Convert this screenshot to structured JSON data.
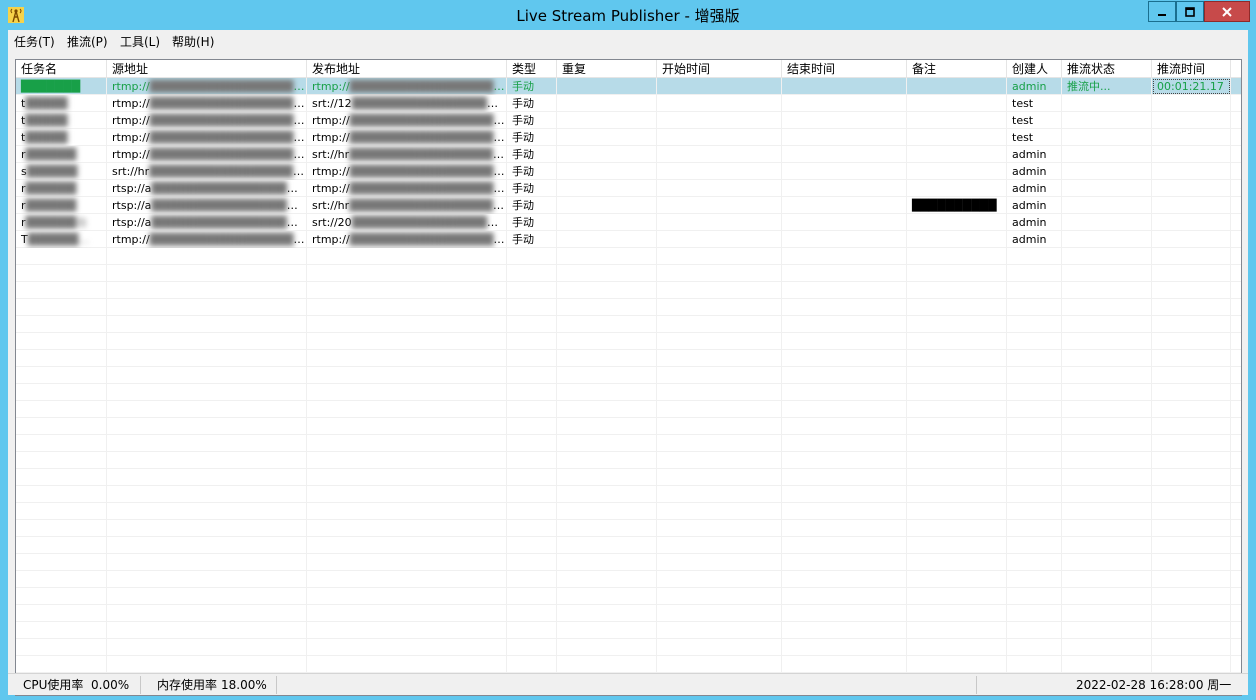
{
  "window": {
    "title": "Live Stream Publisher - 增强版",
    "app_icon": "broadcast-tower-icon"
  },
  "menu": [
    {
      "label": "任务(T)"
    },
    {
      "label": "推流(P)"
    },
    {
      "label": "工具(L)"
    },
    {
      "label": "帮助(H)"
    }
  ],
  "table": {
    "columns": [
      "任务名",
      "源地址",
      "发布地址",
      "类型",
      "重复",
      "开始时间",
      "结束时间",
      "备注",
      "创建人",
      "推流状态",
      "推流时间"
    ],
    "rows": [
      {
        "name": "███████",
        "source": "rtmp://███████████████████████",
        "target": "rtmp://████████████████████████",
        "type": "手动",
        "repeat": "",
        "start": "",
        "end": "",
        "note": "",
        "creator": "admin",
        "status": "推流中...",
        "time": "00:01:21.17"
      },
      {
        "name": "t█████",
        "source": "rtmp://███████████████████████",
        "target": "srt://12███████████████████████",
        "type": "手动",
        "repeat": "",
        "start": "",
        "end": "",
        "note": "",
        "creator": "test",
        "status": "",
        "time": ""
      },
      {
        "name": "t█████",
        "source": "rtmp://███████████████████████",
        "target": "rtmp://████████████████████████",
        "type": "手动",
        "repeat": "",
        "start": "",
        "end": "",
        "note": "",
        "creator": "test",
        "status": "",
        "time": ""
      },
      {
        "name": "t█████",
        "source": "rtmp://███████████████████████",
        "target": "rtmp://████████████████████████",
        "type": "手动",
        "repeat": "",
        "start": "",
        "end": "",
        "note": "",
        "creator": "test",
        "status": "",
        "time": ""
      },
      {
        "name": "r██████",
        "source": "rtmp://███████████████████████",
        "target": "srt://hr███████████████████████",
        "type": "手动",
        "repeat": "",
        "start": "",
        "end": "",
        "note": "",
        "creator": "admin",
        "status": "",
        "time": ""
      },
      {
        "name": "s██████",
        "source": "srt://hr███████████████████████",
        "target": "rtmp://████████████████████████",
        "type": "手动",
        "repeat": "",
        "start": "",
        "end": "",
        "note": "",
        "creator": "admin",
        "status": "",
        "time": ""
      },
      {
        "name": "r██████",
        "source": "rtsp://a██████████████████████",
        "target": "rtmp://████████████████████████",
        "type": "手动",
        "repeat": "",
        "start": "",
        "end": "",
        "note": "",
        "creator": "admin",
        "status": "",
        "time": ""
      },
      {
        "name": "r██████",
        "source": "rtsp://a██████████████████████",
        "target": "srt://hr███████████████████████",
        "type": "手动",
        "repeat": "",
        "start": "",
        "end": "",
        "note": "██████████",
        "creator": "admin",
        "status": "",
        "time": ""
      },
      {
        "name": "r██████台",
        "source": "rtsp://a██████████████████████",
        "target": "srt://20███████████████████████",
        "type": "手动",
        "repeat": "",
        "start": "",
        "end": "",
        "note": "",
        "creator": "admin",
        "status": "",
        "time": ""
      },
      {
        "name": "T██████...",
        "source": "rtmp://███████████████████████",
        "target": "rtmp://███████████████████████/...",
        "type": "手动",
        "repeat": "",
        "start": "",
        "end": "",
        "note": "",
        "creator": "admin",
        "status": "",
        "time": ""
      }
    ]
  },
  "statusbar": {
    "cpu_label": "CPU使用率",
    "cpu_value": "0.00%",
    "mem_label": "内存使用率",
    "mem_value": "18.00%",
    "datetime": "2022-02-28 16:28:00 周一"
  },
  "colors": {
    "titlebar": "#60c7ee",
    "selected_row": "#b7dbe8",
    "streaming_text": "#18a048",
    "close_button": "#c74a4a"
  }
}
